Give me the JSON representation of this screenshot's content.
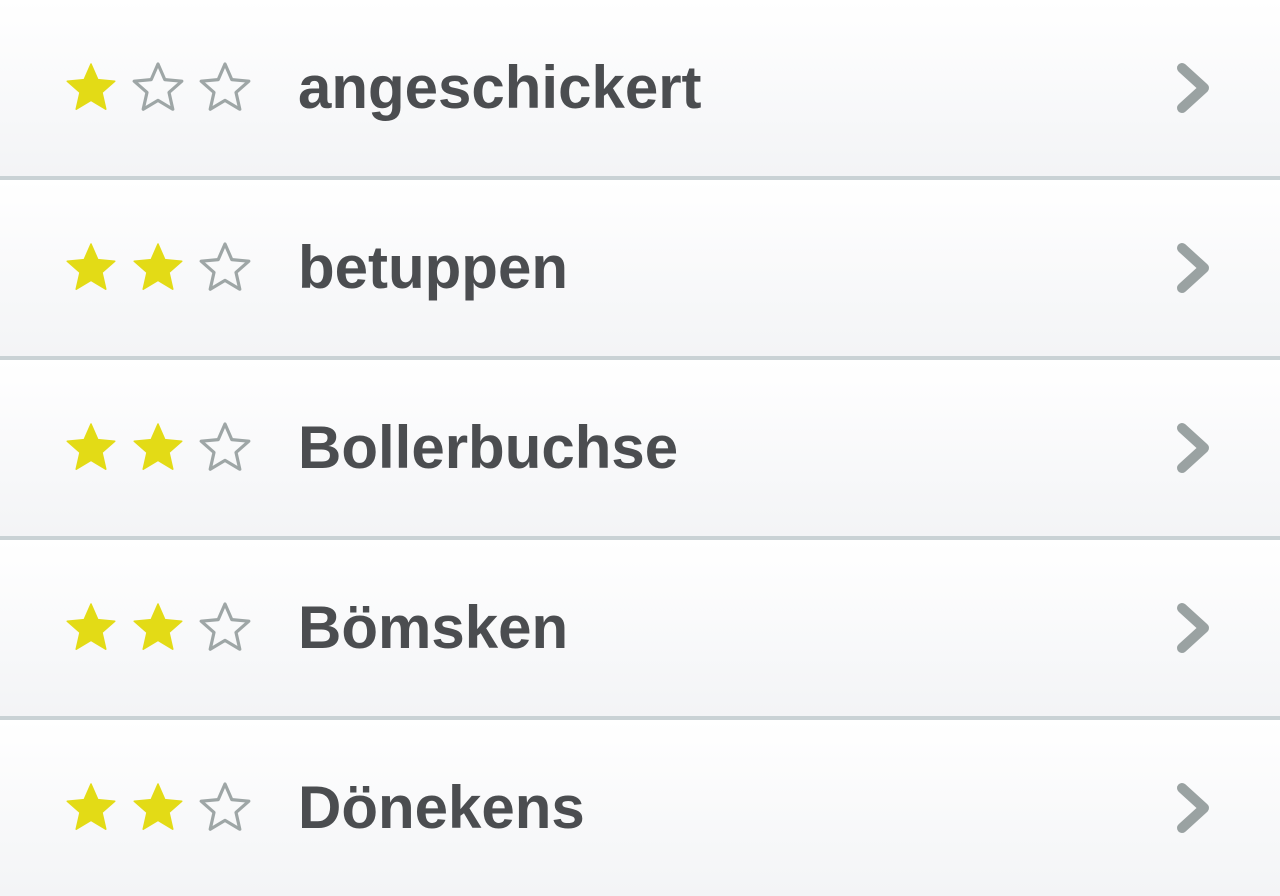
{
  "colors": {
    "star_filled": "#e3db16",
    "star_empty_outline": "#9ea6a6",
    "chevron": "#9aa2a2",
    "text": "#4b4d50",
    "divider": "#c9d2d5"
  },
  "list": {
    "items": [
      {
        "label": "angeschickert",
        "rating": 1,
        "max_rating": 3
      },
      {
        "label": "betuppen",
        "rating": 2,
        "max_rating": 3
      },
      {
        "label": "Bollerbuchse",
        "rating": 2,
        "max_rating": 3
      },
      {
        "label": "Bömsken",
        "rating": 2,
        "max_rating": 3
      },
      {
        "label": "Dönekens",
        "rating": 2,
        "max_rating": 3
      }
    ],
    "chevron_icon": "chevron-right-icon",
    "star_icon": "star-icon"
  }
}
